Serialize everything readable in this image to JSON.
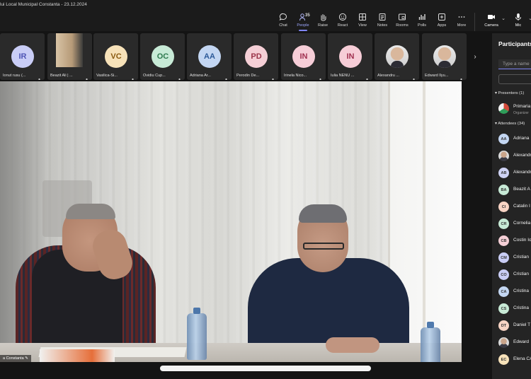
{
  "meeting": {
    "title": "lui Local Municipal Constanta - 23.12.2024"
  },
  "toolbar": {
    "items": [
      {
        "label": "Chat"
      },
      {
        "label": "People",
        "count": "35"
      },
      {
        "label": "Raise"
      },
      {
        "label": "React"
      },
      {
        "label": "View"
      },
      {
        "label": "Notes"
      },
      {
        "label": "Rooms"
      },
      {
        "label": "Polls"
      },
      {
        "label": "Apps"
      },
      {
        "label": "More"
      }
    ],
    "camera_label": "Camera",
    "mic_label": "Mic"
  },
  "strip": {
    "tiles": [
      {
        "initials": "IR",
        "name": "Ionut rusu (...",
        "color": "#c9cdf6",
        "text_color": "#4f55b5"
      },
      {
        "initials": "",
        "name": "Beazit Ali | ...",
        "photo": "wide"
      },
      {
        "initials": "VC",
        "name": "Vasilica-Si...",
        "color": "#f7e2b9",
        "text_color": "#8a5a10"
      },
      {
        "initials": "OC",
        "name": "Ovidiu Cup...",
        "color": "#c7ead6",
        "text_color": "#2e7a4f"
      },
      {
        "initials": "AA",
        "name": "Adriana Ar...",
        "color": "#c3d6f2",
        "text_color": "#2d5a99"
      },
      {
        "initials": "PD",
        "name": "Perodin De...",
        "color": "#f5cfd6",
        "text_color": "#9a3348"
      },
      {
        "initials": "IN",
        "name": "Irinela Nico...",
        "color": "#f6cdd7",
        "text_color": "#a03050"
      },
      {
        "initials": "IN",
        "name": "Iulia NENU ...",
        "color": "#f6cdd7",
        "text_color": "#a03050"
      },
      {
        "initials": "",
        "name": "Alexandru ...",
        "photo": "face"
      },
      {
        "initials": "",
        "name": "Edward Ilyu...",
        "photo": "face"
      }
    ]
  },
  "video": {
    "caption": "a Constanta"
  },
  "participants": {
    "title": "Participants",
    "search_placeholder": "Type a name",
    "presenters_header": "Presenters (1)",
    "presenter": {
      "name": "Primaria",
      "role": "Organizer"
    },
    "attendees_header": "Attendees (34)",
    "attendees": [
      {
        "initials": "AA",
        "name": "Adriana",
        "color": "#c3d6f2"
      },
      {
        "initials": "",
        "name": "Alexandr",
        "photo": true
      },
      {
        "initials": "AB",
        "name": "Alexandr",
        "color": "#cfd3f5"
      },
      {
        "initials": "BA",
        "name": "Beazit A",
        "color": "#c7ead6"
      },
      {
        "initials": "CI",
        "name": "Catalin I",
        "color": "#f8d4c4"
      },
      {
        "initials": "CR",
        "name": "Cornelia",
        "color": "#c7ead6"
      },
      {
        "initials": "CB",
        "name": "Costin Io",
        "color": "#f5cfd6"
      },
      {
        "initials": "CM",
        "name": "Cristian",
        "color": "#c9cdf6"
      },
      {
        "initials": "CO",
        "name": "Cristian",
        "color": "#c9cdf6"
      },
      {
        "initials": "CA",
        "name": "Cristina",
        "color": "#c3d6f2"
      },
      {
        "initials": "CS",
        "name": "Cristina",
        "color": "#c7ead6"
      },
      {
        "initials": "DT",
        "name": "Daniel T",
        "color": "#f8d4c4"
      },
      {
        "initials": "",
        "name": "Edward",
        "photo": true
      },
      {
        "initials": "EC",
        "name": "Elena CA",
        "color": "#f7e2b9"
      }
    ]
  }
}
